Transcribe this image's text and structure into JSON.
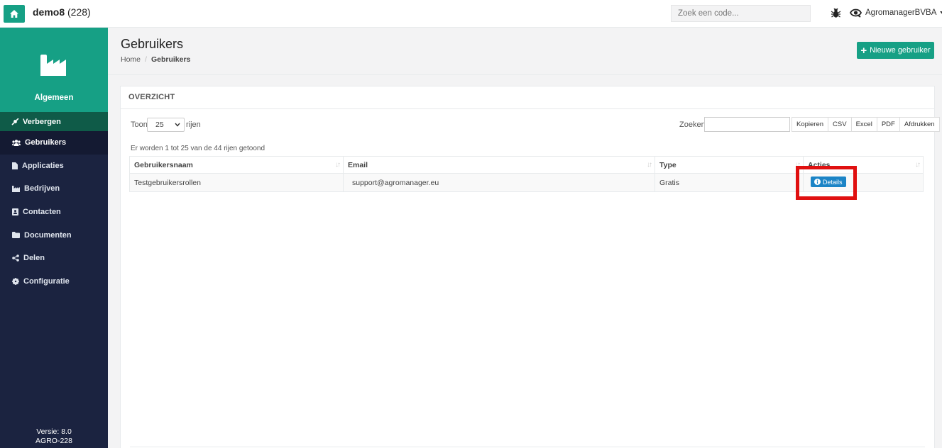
{
  "topbar": {
    "app_name": "demo8",
    "app_count": "(228)",
    "search_placeholder": "Zoek een code...",
    "user_name": "AgromanagerBVBA"
  },
  "sidebar": {
    "header_label": "Algemeen",
    "hide_label": "Verbergen",
    "items": [
      {
        "label": "Gebruikers",
        "icon": "users-icon",
        "active": true
      },
      {
        "label": "Applicaties",
        "icon": "file-icon"
      },
      {
        "label": "Bedrijven",
        "icon": "industry-icon"
      },
      {
        "label": "Contacten",
        "icon": "address-book-icon"
      },
      {
        "label": "Documenten",
        "icon": "folder-icon"
      },
      {
        "label": "Delen",
        "icon": "share-icon"
      },
      {
        "label": "Configuratie",
        "icon": "gear-icon"
      }
    ],
    "footer_version": "Versie: 8.0",
    "footer_code": "AGRO-228"
  },
  "page": {
    "title": "Gebruikers",
    "breadcrumb": [
      "Home",
      "Gebruikers"
    ],
    "new_user_label": "Nieuwe gebruiker"
  },
  "panel": {
    "title": "OVERZICHT",
    "show_label": "Toon",
    "rows_value": "25",
    "rows_suffix": "rijen",
    "search_label": "Zoeken",
    "export_buttons": [
      "Kopieren",
      "CSV",
      "Excel",
      "PDF",
      "Afdrukken"
    ],
    "info": "Er worden 1 tot 25 van de 44 rijen getoond",
    "columns": [
      "Gebruikersnaam",
      "Email",
      "Type",
      "Acties"
    ],
    "rows": [
      {
        "username": "Testgebruikersrollen",
        "email": "support@agromanager.eu",
        "type": "Gratis",
        "action": "Details"
      }
    ]
  },
  "colors": {
    "accent": "#16a085",
    "sidebar": "#1b2340",
    "details_button": "#1c84c6",
    "highlight": "#e01010"
  }
}
